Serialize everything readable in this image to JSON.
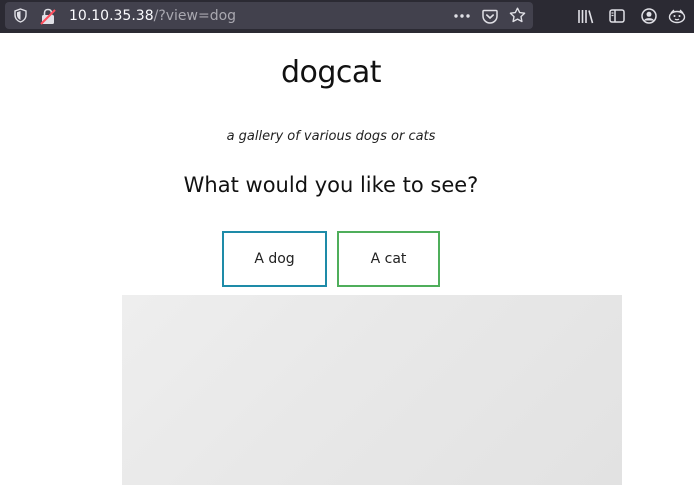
{
  "browser": {
    "url_host": "10.10.35.38",
    "url_path": "/?view=dog",
    "icons": {
      "shield": "shield-icon",
      "insecure_lock": "insecure-lock-icon",
      "more": "more-options-icon",
      "pocket": "pocket-icon",
      "bookmark": "bookmark-star-icon",
      "library": "library-icon",
      "sidebar": "sidebar-icon",
      "account": "account-icon",
      "extension": "extension-icon"
    }
  },
  "page": {
    "title": "dogcat",
    "subtitle": "a gallery of various dogs or cats",
    "question": "What would you like to see?",
    "buttons": {
      "dog": "A dog",
      "cat": "A cat"
    }
  },
  "colors": {
    "toolbar_bg": "#2b2a33",
    "urlbar_bg": "#42414d",
    "dog_button_border": "#1e8ba8",
    "cat_button_border": "#4fae5b"
  }
}
